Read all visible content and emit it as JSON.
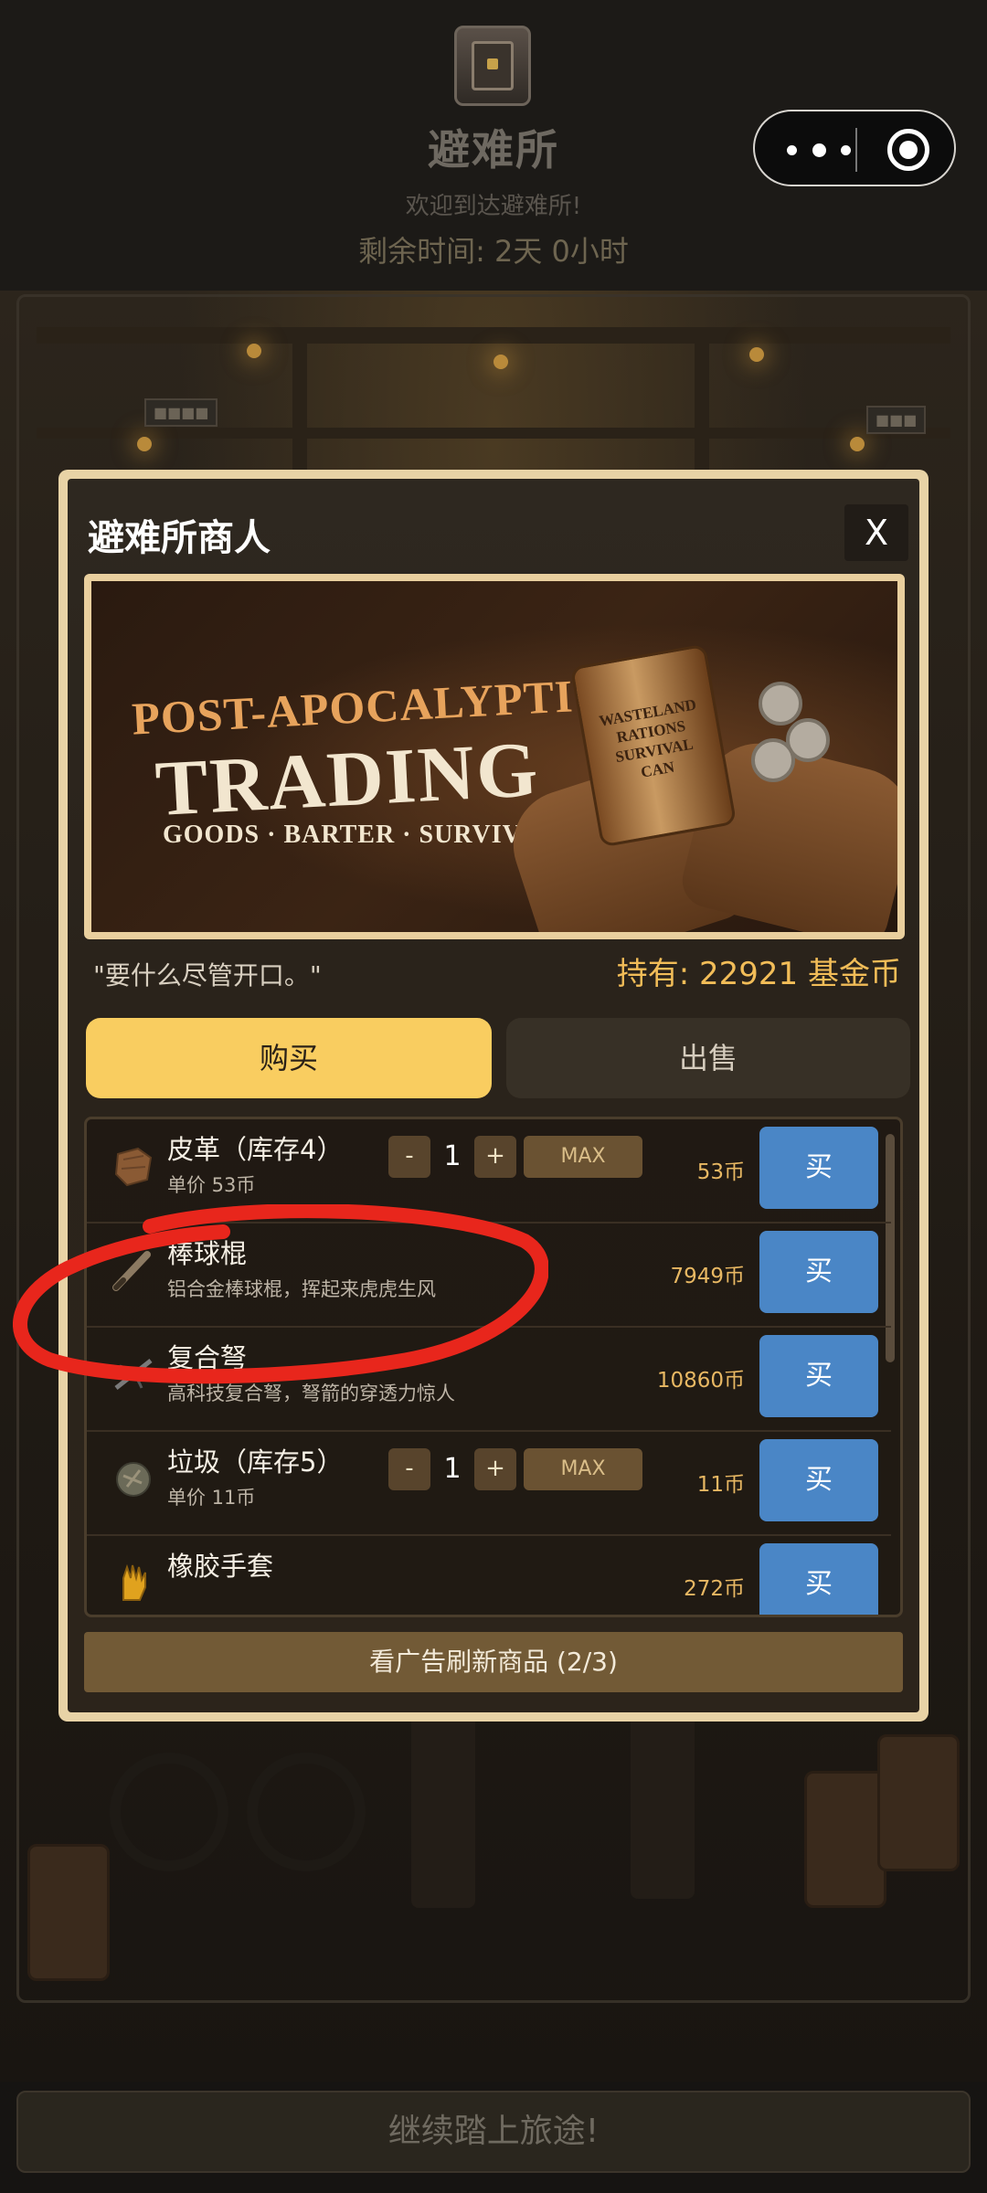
{
  "header": {
    "title": "避难所",
    "welcome": "欢迎到达避难所!",
    "remaining_time": "剩余时间: 2天 0小时"
  },
  "capsule": {
    "icons": [
      "more-icon",
      "target-icon"
    ]
  },
  "merchant": {
    "title": "避难所商人",
    "close_label": "X",
    "banner": {
      "line1": "POST-APOCALYPTIC",
      "line2": "TRADING",
      "line3": "GOODS · BARTER · SURVIVAL →",
      "can_label": "WASTELAND RATIONS SURVIVAL CAN"
    },
    "quote": "\"要什么尽管开口。\"",
    "funds": "持有: 22921 基金币",
    "tabs": {
      "buy": "购买",
      "sell": "出售"
    },
    "goods": [
      {
        "name": "皮革（库存4）",
        "sub": "单价 53币",
        "has_stepper": true,
        "qty": "1",
        "minus": "-",
        "plus": "+",
        "max": "MAX",
        "price": "53币",
        "buy": "买",
        "icon": "leather-icon"
      },
      {
        "name": "棒球棍",
        "sub": "铝合金棒球棍，挥起来虎虎生风",
        "has_stepper": false,
        "price": "7949币",
        "buy": "买",
        "icon": "baseball-bat-icon"
      },
      {
        "name": "复合弩",
        "sub": "高科技复合弩，弩箭的穿透力惊人",
        "has_stepper": false,
        "price": "10860币",
        "buy": "买",
        "icon": "crossbow-icon"
      },
      {
        "name": "垃圾（库存5）",
        "sub": "单价 11币",
        "has_stepper": true,
        "qty": "1",
        "minus": "-",
        "plus": "+",
        "max": "MAX",
        "price": "11币",
        "buy": "买",
        "icon": "junk-icon"
      },
      {
        "name": "橡胶手套",
        "sub": "",
        "has_stepper": false,
        "price": "272币",
        "buy": "买",
        "icon": "glove-icon"
      }
    ],
    "refresh_label": "看广告刷新商品 (2/3)"
  },
  "continue_label": "继续踏上旅途!",
  "colors": {
    "accent": "#f9cd60",
    "buy_button": "#4a86c6",
    "price": "#e8b863",
    "annotation": "#e8261c"
  }
}
